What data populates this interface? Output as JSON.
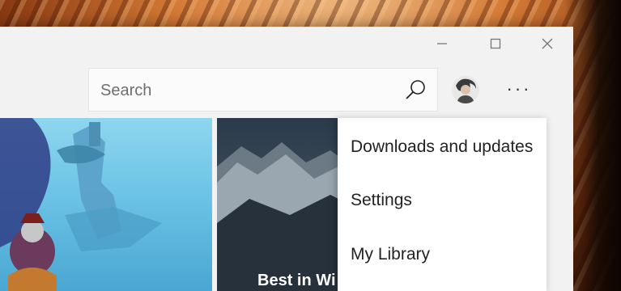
{
  "search": {
    "placeholder": "Search",
    "icon": "search-icon"
  },
  "account": {
    "avatar_icon": "avatar"
  },
  "more": {
    "label": "···"
  },
  "window_controls": [
    "minimize-icon",
    "maximize-icon",
    "close-icon"
  ],
  "featured": {
    "right_tile_caption": "Best in Wi"
  },
  "menu": {
    "items": [
      {
        "label": "Downloads and updates"
      },
      {
        "label": "Settings"
      },
      {
        "label": "My Library"
      }
    ]
  },
  "colors": {
    "menu_bg": "#ffffff",
    "window_bg": "#f2f2f2",
    "search_bg": "#fbfbfb"
  }
}
